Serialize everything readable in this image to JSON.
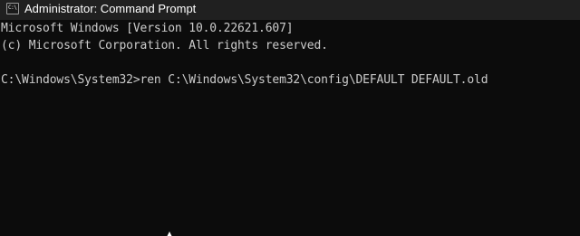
{
  "window": {
    "title": "Administrator: Command Prompt",
    "icon": "cmd-icon",
    "icon_glyph": "C:\\"
  },
  "console": {
    "lines": [
      "Microsoft Windows [Version 10.0.22621.607]",
      "(c) Microsoft Corporation. All rights reserved.",
      "C:\\Windows\\System32>ren C:\\Windows\\System32\\config\\DEFAULT DEFAULT.old"
    ]
  },
  "colors": {
    "console_background": "#0c0c0c",
    "console_text": "#cccccc",
    "titlebar_background": "#202020",
    "title_text": "#ffffff"
  },
  "mouse_pointer": "arrow-cursor-icon"
}
